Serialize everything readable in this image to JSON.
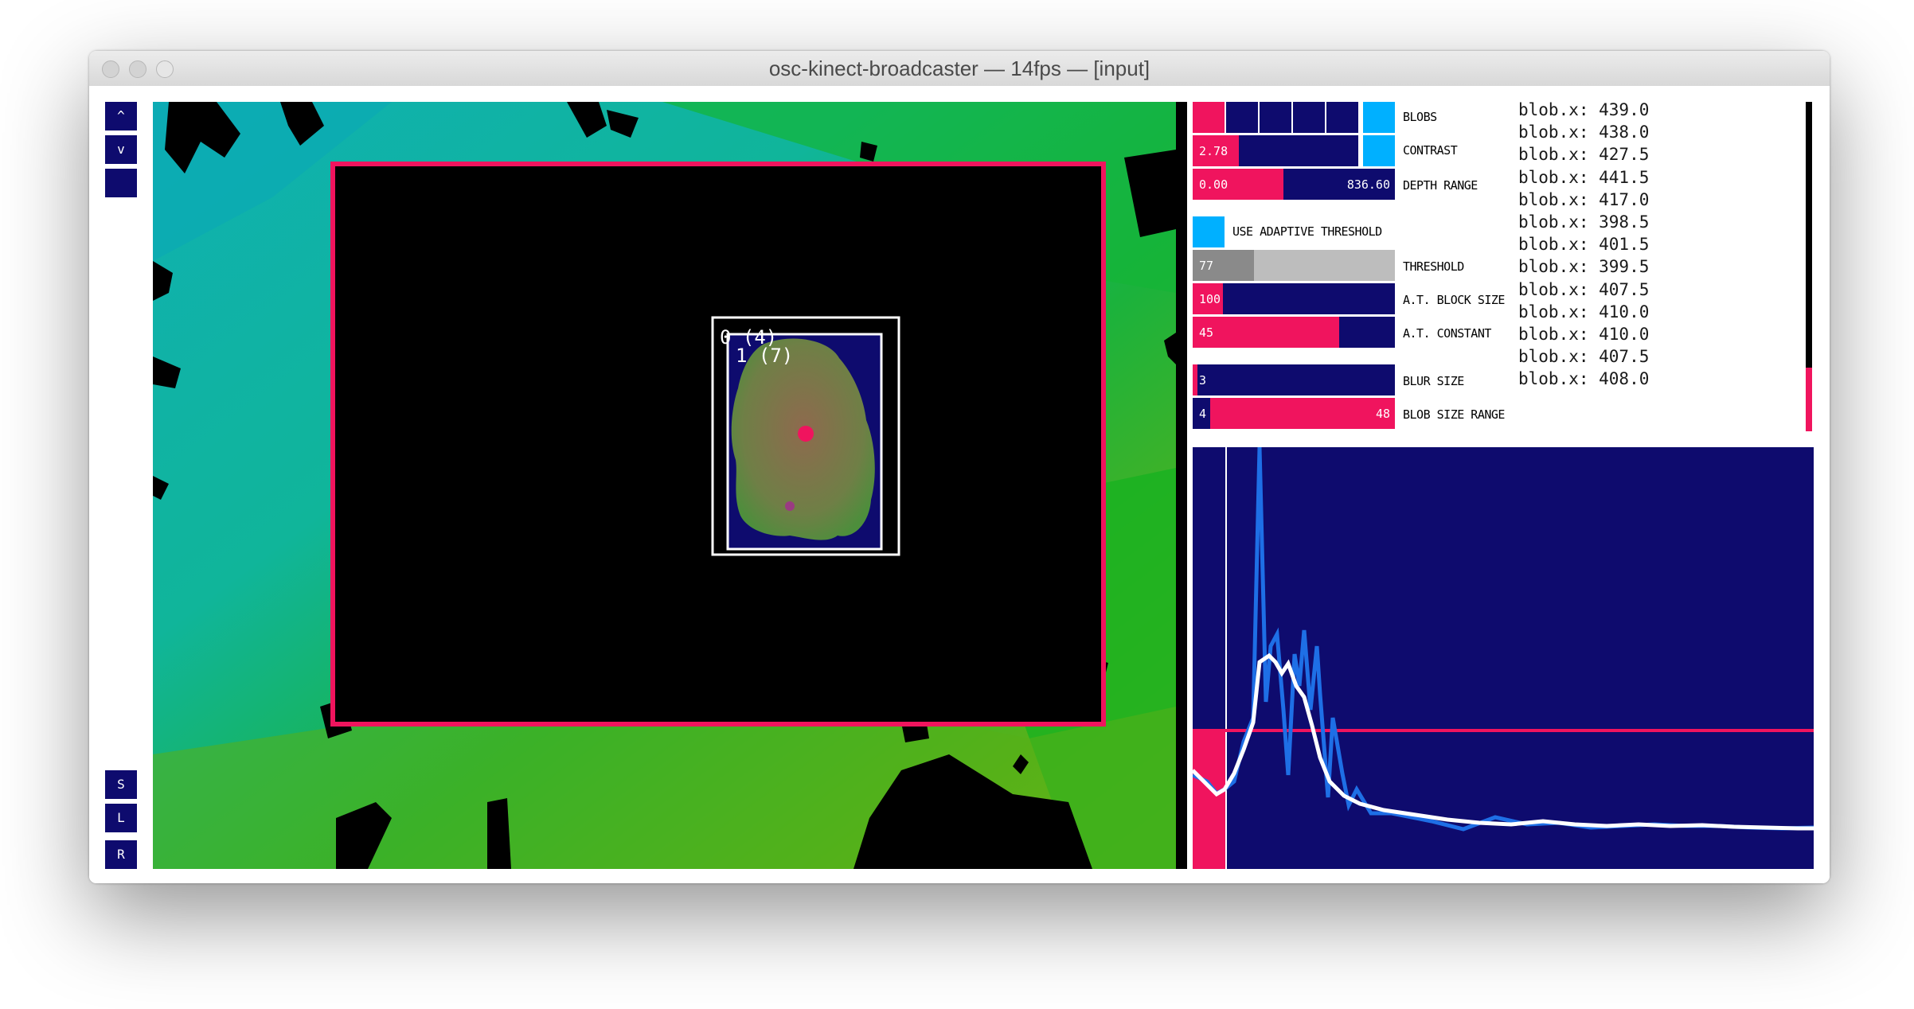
{
  "window": {
    "title": "osc-kinect-broadcaster — 14fps — [input]"
  },
  "side_buttons": {
    "up": "^",
    "down": "v",
    "blank": "",
    "save": "S",
    "load": "L",
    "reset": "R"
  },
  "view": {
    "blobs": [
      {
        "label": "0 (4)"
      },
      {
        "label": "1 (7)"
      }
    ]
  },
  "controls": {
    "blobs": {
      "label": "BLOBS",
      "count_cells": 4
    },
    "contrast": {
      "label": "CONTRAST",
      "value": "2.78"
    },
    "depth_range": {
      "label": "DEPTH RANGE",
      "min": "0.00",
      "max": "836.60"
    },
    "adaptive": {
      "label": "USE ADAPTIVE THRESHOLD",
      "checked": true
    },
    "threshold": {
      "label": "THRESHOLD",
      "value": "77"
    },
    "block_size": {
      "label": "A.T. BLOCK SIZE",
      "value": "100"
    },
    "constant": {
      "label": "A.T. CONSTANT",
      "value": "45"
    },
    "blur": {
      "label": "BLUR SIZE",
      "value": "3"
    },
    "blob_size": {
      "label": "BLOB SIZE RANGE",
      "min": "4",
      "max": "48"
    }
  },
  "blob_log": [
    "blob.x: 439.0",
    "blob.x: 438.0",
    "blob.x: 427.5",
    "blob.x: 441.5",
    "blob.x: 417.0",
    "blob.x: 398.5",
    "blob.x: 401.5",
    "blob.x: 399.5",
    "blob.x: 407.5",
    "blob.x: 410.0",
    "blob.x: 410.0",
    "blob.x: 407.5",
    "blob.x: 408.0"
  ],
  "colors": {
    "navy": "#0e0b6e",
    "pink": "#f0145e",
    "cyan": "#00b0ff",
    "raw_line": "#1e6fe6",
    "smooth_line": "#ffffff",
    "gray": "#bdbdbd"
  },
  "icons": {
    "up": "caret-up-icon",
    "down": "caret-down-icon",
    "close": "close-icon",
    "minimize": "minimize-icon",
    "zoom": "zoom-icon"
  }
}
